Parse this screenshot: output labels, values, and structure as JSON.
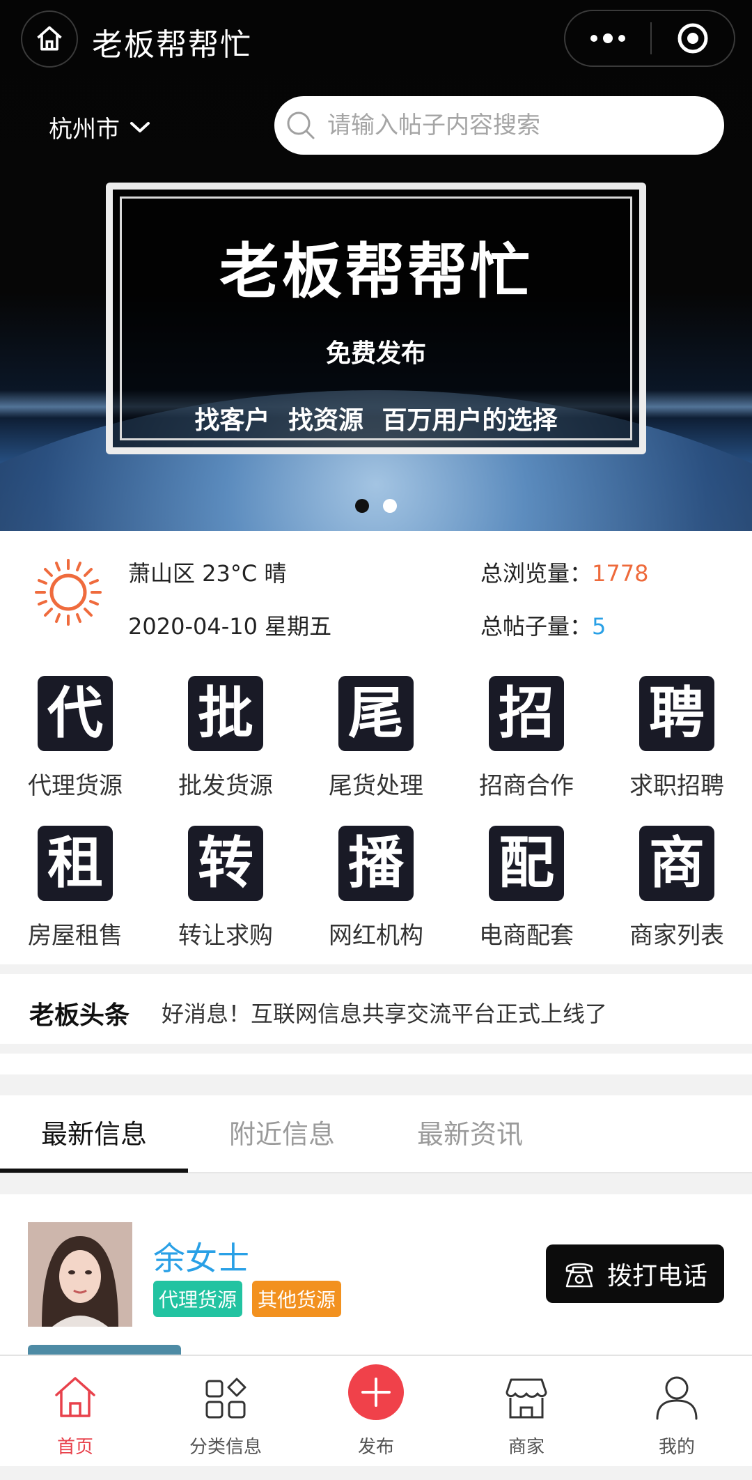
{
  "app": {
    "title": "老板帮帮忙"
  },
  "header": {
    "city": "杭州市",
    "search_placeholder": "请输入帖子内容搜索"
  },
  "banner": {
    "title": "老板帮帮忙",
    "subtitle": "免费发布",
    "tagline": "找客户 找资源 百万用户的选择",
    "slides": 2,
    "active_slide": 1
  },
  "weather": {
    "location_temp": "萧山区 23°C 晴",
    "date": "2020-04-10 星期五",
    "icon": "sun-icon"
  },
  "stats": {
    "views_label": "总浏览量：",
    "views_value": "1778",
    "posts_label": "总帖子量：",
    "posts_value": "5"
  },
  "categories": [
    {
      "char": "代",
      "label": "代理货源"
    },
    {
      "char": "批",
      "label": "批发货源"
    },
    {
      "char": "尾",
      "label": "尾货处理"
    },
    {
      "char": "招",
      "label": "招商合作"
    },
    {
      "char": "聘",
      "label": "求职招聘"
    },
    {
      "char": "租",
      "label": "房屋租售"
    },
    {
      "char": "转",
      "label": "转让求购"
    },
    {
      "char": "播",
      "label": "网红机构"
    },
    {
      "char": "配",
      "label": "电商配套"
    },
    {
      "char": "商",
      "label": "商家列表"
    }
  ],
  "headline": {
    "tag": "老板头条",
    "text": "好消息！互联网信息共享交流平台正式上线了"
  },
  "tabs": [
    {
      "label": "最新信息",
      "active": true
    },
    {
      "label": "附近信息",
      "active": false
    },
    {
      "label": "最新资讯",
      "active": false
    }
  ],
  "post": {
    "name": "余女士",
    "tags": [
      "代理货源",
      "其他货源"
    ],
    "call_label": "拨打电话"
  },
  "tabbar": [
    {
      "label": "首页",
      "icon": "home-icon",
      "active": true
    },
    {
      "label": "分类信息",
      "icon": "category-icon",
      "active": false
    },
    {
      "label": "发布",
      "icon": "publish-plus-icon",
      "active": false
    },
    {
      "label": "商家",
      "icon": "shop-icon",
      "active": false
    },
    {
      "label": "我的",
      "icon": "user-icon",
      "active": false
    }
  ],
  "colors": {
    "accent_red": "#e8414b",
    "stat_orange": "#ee6a3b",
    "stat_blue": "#29a0e6",
    "tag_green": "#22c3a1",
    "tag_orange": "#f2911f"
  }
}
